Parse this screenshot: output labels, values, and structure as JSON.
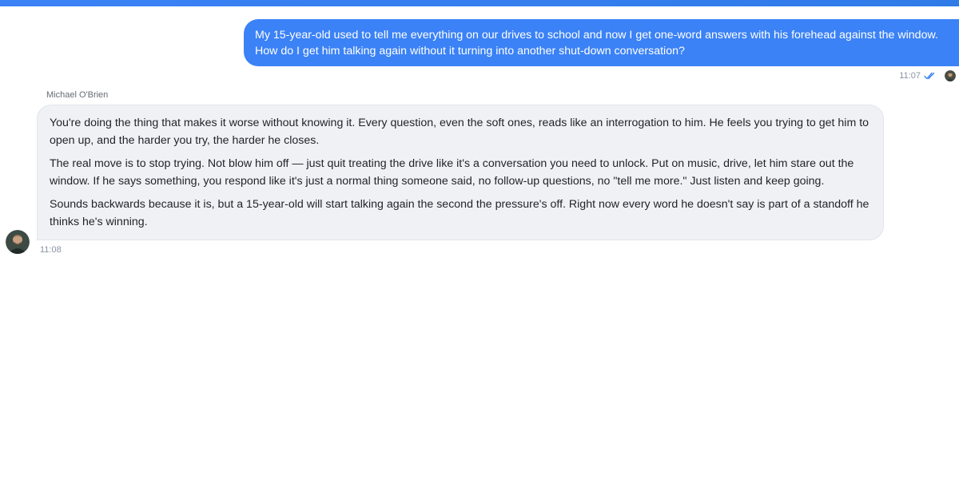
{
  "conversation": {
    "outgoing": {
      "text": "My 15-year-old used to tell me everything on our drives to school and now I get one-word answers with his forehead against the window. How do I get him talking again without it turning into another shut-down conversation?",
      "time": "11:07",
      "status_icon": "double-check-icon",
      "status_color": "#3b82f6"
    },
    "incoming": {
      "sender": "Michael O'Brien",
      "paragraphs": [
        "You're doing the thing that makes it worse without knowing it. Every question, even the soft ones, reads like an interrogation to him. He feels you trying to get him to open up, and the harder you try, the harder he closes.",
        "The real move is to stop trying. Not blow him off — just quit treating the drive like it's a conversation you need to unlock. Put on music, drive, let him stare out the window. If he says something, you respond like it's just a normal thing someone said, no follow-up questions, no \"tell me more.\" Just listen and keep going.",
        "Sounds backwards because it is, but a 15-year-old will start talking again the second the pressure's off. Right now every word he doesn't say is part of a standoff he thinks he's winning."
      ],
      "time": "11:08"
    }
  },
  "colors": {
    "accent": "#3b82f6",
    "incoming_bubble": "#eff1f5",
    "text": "#1f2329",
    "meta": "#8a93a3"
  }
}
